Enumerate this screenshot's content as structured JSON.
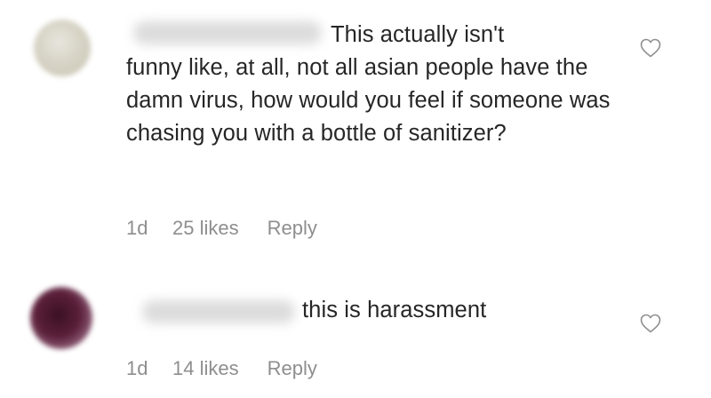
{
  "comments": [
    {
      "line1": "This actually isn't",
      "rest": "funny like, at all, not all asian people have the damn virus, how would you feel if someone was chasing you with a bottle of sanitizer?",
      "time": "1d",
      "likes": "25 likes",
      "reply": "Reply",
      "icon": "heart-outline-icon"
    },
    {
      "text": "this is harassment",
      "time": "1d",
      "likes": "14 likes",
      "reply": "Reply",
      "icon": "heart-outline-icon"
    }
  ],
  "colors": {
    "text": "#262626",
    "meta": "#8e8e8e"
  }
}
